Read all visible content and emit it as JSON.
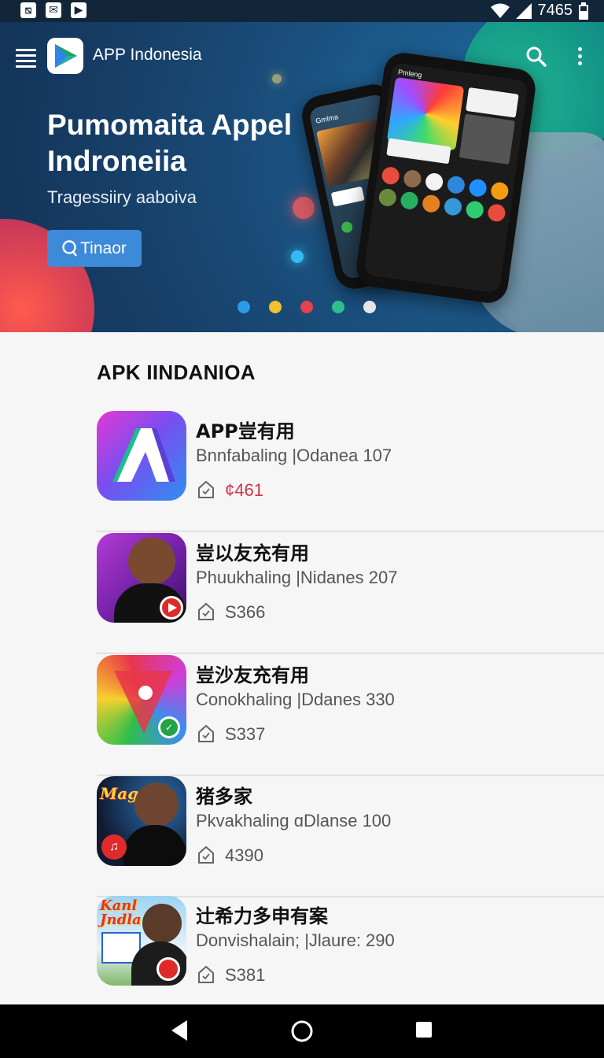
{
  "status_bar": {
    "time": "7465",
    "left_icons": [
      "image-icon",
      "mail-icon",
      "play-icon"
    ],
    "right_icons": [
      "wifi-icon",
      "signal-icon",
      "battery-icon"
    ]
  },
  "header": {
    "app_title": "APP Indonesia",
    "logo_icon": "play-store-logo"
  },
  "hero": {
    "headline": "Pumomaita Appel Indroneiia",
    "subtitle": "Tragessiiry aaboiva",
    "button_label": "Tinaor",
    "phone_labels": [
      "Pmleng",
      "Gmlma"
    ],
    "carousel_dots": [
      "#2a9be6",
      "#f2c12e",
      "#e8404c",
      "#2fbf8e",
      "#e6e6e6"
    ]
  },
  "section": {
    "title": "APK IINDANIOA"
  },
  "apps": [
    {
      "name": "APP豈有用",
      "developer": "Bnnfabaling |Odanea 107",
      "price": "¢461",
      "price_color": "#d3324a"
    },
    {
      "name": "豈以友充有用",
      "developer": "Phuukhaling |Nidanes 207",
      "price": "S366"
    },
    {
      "name": "豈沙友充有用",
      "developer": "Conokhaling |Ddanes 330",
      "price": "S337"
    },
    {
      "name": "猪多家",
      "developer": "Pkvakhaling ɑDlanse 100",
      "price": "4390"
    },
    {
      "name": "辻希力多申有案",
      "developer": "Donvishalain; |Jlaure: 290",
      "price": "S381"
    }
  ],
  "icon_labels": [
    "Magalla",
    "Kanl Jndla"
  ]
}
